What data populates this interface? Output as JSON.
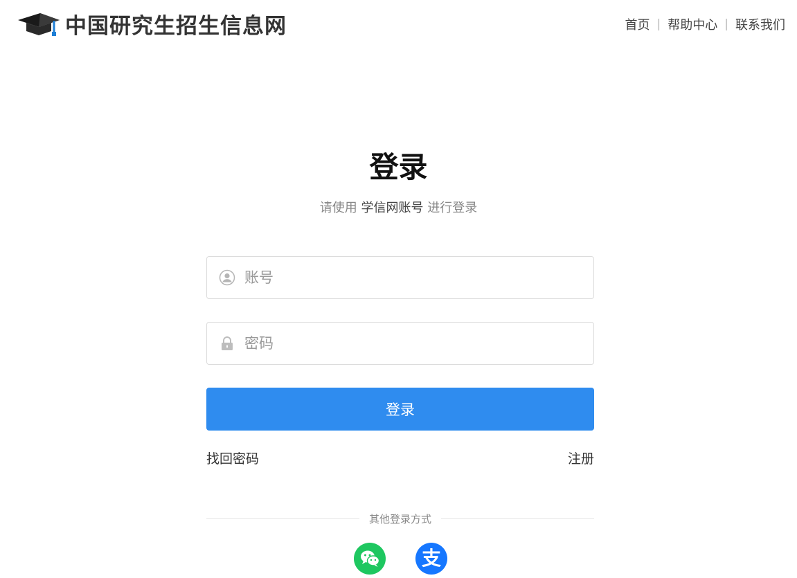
{
  "header": {
    "site_title": "中国研究生招生信息网",
    "nav": [
      {
        "label": "首页"
      },
      {
        "label": "帮助中心"
      },
      {
        "label": "联系我们"
      }
    ],
    "separator": "|"
  },
  "login": {
    "title": "登录",
    "subtitle_prefix": "请使用",
    "subtitle_account": "学信网账号",
    "subtitle_suffix": "进行登录",
    "account_placeholder": "账号",
    "account_icon": "user-circle-icon",
    "password_placeholder": "密码",
    "password_icon": "lock-icon",
    "button_label": "登录",
    "forgot_password": "找回密码",
    "register": "注册",
    "other_methods": "其他登录方式",
    "social": [
      {
        "name": "wechat",
        "icon": "wechat-icon",
        "color": "#1ec760"
      },
      {
        "name": "alipay",
        "icon": "alipay-icon",
        "glyph": "支",
        "color": "#1677ff"
      }
    ]
  },
  "colors": {
    "accent": "#2f8cef",
    "text": "#333333",
    "muted": "#888888",
    "border": "#dcdcdc"
  }
}
